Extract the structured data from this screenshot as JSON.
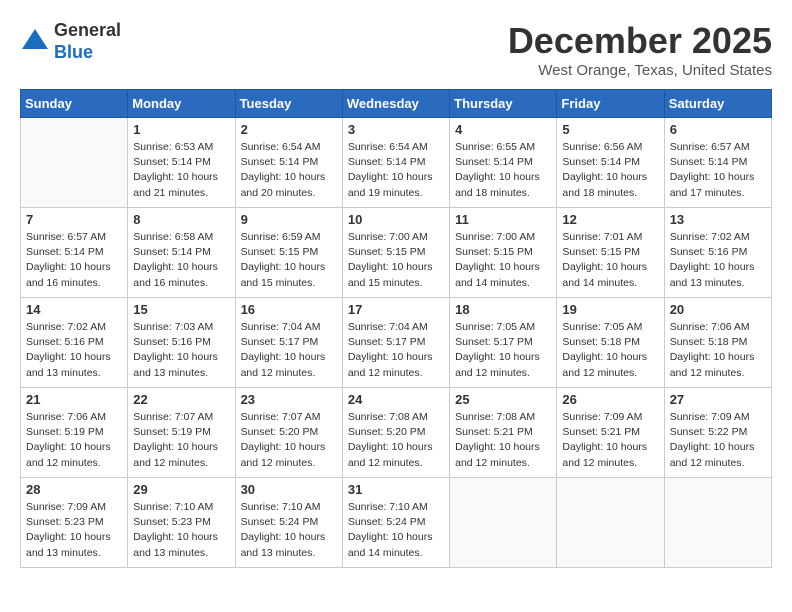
{
  "header": {
    "logo_line1": "General",
    "logo_line2": "Blue",
    "month": "December 2025",
    "location": "West Orange, Texas, United States"
  },
  "weekdays": [
    "Sunday",
    "Monday",
    "Tuesday",
    "Wednesday",
    "Thursday",
    "Friday",
    "Saturday"
  ],
  "weeks": [
    [
      {
        "day": "",
        "sunrise": "",
        "sunset": "",
        "daylight": ""
      },
      {
        "day": "1",
        "sunrise": "Sunrise: 6:53 AM",
        "sunset": "Sunset: 5:14 PM",
        "daylight": "Daylight: 10 hours and 21 minutes."
      },
      {
        "day": "2",
        "sunrise": "Sunrise: 6:54 AM",
        "sunset": "Sunset: 5:14 PM",
        "daylight": "Daylight: 10 hours and 20 minutes."
      },
      {
        "day": "3",
        "sunrise": "Sunrise: 6:54 AM",
        "sunset": "Sunset: 5:14 PM",
        "daylight": "Daylight: 10 hours and 19 minutes."
      },
      {
        "day": "4",
        "sunrise": "Sunrise: 6:55 AM",
        "sunset": "Sunset: 5:14 PM",
        "daylight": "Daylight: 10 hours and 18 minutes."
      },
      {
        "day": "5",
        "sunrise": "Sunrise: 6:56 AM",
        "sunset": "Sunset: 5:14 PM",
        "daylight": "Daylight: 10 hours and 18 minutes."
      },
      {
        "day": "6",
        "sunrise": "Sunrise: 6:57 AM",
        "sunset": "Sunset: 5:14 PM",
        "daylight": "Daylight: 10 hours and 17 minutes."
      }
    ],
    [
      {
        "day": "7",
        "sunrise": "Sunrise: 6:57 AM",
        "sunset": "Sunset: 5:14 PM",
        "daylight": "Daylight: 10 hours and 16 minutes."
      },
      {
        "day": "8",
        "sunrise": "Sunrise: 6:58 AM",
        "sunset": "Sunset: 5:14 PM",
        "daylight": "Daylight: 10 hours and 16 minutes."
      },
      {
        "day": "9",
        "sunrise": "Sunrise: 6:59 AM",
        "sunset": "Sunset: 5:15 PM",
        "daylight": "Daylight: 10 hours and 15 minutes."
      },
      {
        "day": "10",
        "sunrise": "Sunrise: 7:00 AM",
        "sunset": "Sunset: 5:15 PM",
        "daylight": "Daylight: 10 hours and 15 minutes."
      },
      {
        "day": "11",
        "sunrise": "Sunrise: 7:00 AM",
        "sunset": "Sunset: 5:15 PM",
        "daylight": "Daylight: 10 hours and 14 minutes."
      },
      {
        "day": "12",
        "sunrise": "Sunrise: 7:01 AM",
        "sunset": "Sunset: 5:15 PM",
        "daylight": "Daylight: 10 hours and 14 minutes."
      },
      {
        "day": "13",
        "sunrise": "Sunrise: 7:02 AM",
        "sunset": "Sunset: 5:16 PM",
        "daylight": "Daylight: 10 hours and 13 minutes."
      }
    ],
    [
      {
        "day": "14",
        "sunrise": "Sunrise: 7:02 AM",
        "sunset": "Sunset: 5:16 PM",
        "daylight": "Daylight: 10 hours and 13 minutes."
      },
      {
        "day": "15",
        "sunrise": "Sunrise: 7:03 AM",
        "sunset": "Sunset: 5:16 PM",
        "daylight": "Daylight: 10 hours and 13 minutes."
      },
      {
        "day": "16",
        "sunrise": "Sunrise: 7:04 AM",
        "sunset": "Sunset: 5:17 PM",
        "daylight": "Daylight: 10 hours and 12 minutes."
      },
      {
        "day": "17",
        "sunrise": "Sunrise: 7:04 AM",
        "sunset": "Sunset: 5:17 PM",
        "daylight": "Daylight: 10 hours and 12 minutes."
      },
      {
        "day": "18",
        "sunrise": "Sunrise: 7:05 AM",
        "sunset": "Sunset: 5:17 PM",
        "daylight": "Daylight: 10 hours and 12 minutes."
      },
      {
        "day": "19",
        "sunrise": "Sunrise: 7:05 AM",
        "sunset": "Sunset: 5:18 PM",
        "daylight": "Daylight: 10 hours and 12 minutes."
      },
      {
        "day": "20",
        "sunrise": "Sunrise: 7:06 AM",
        "sunset": "Sunset: 5:18 PM",
        "daylight": "Daylight: 10 hours and 12 minutes."
      }
    ],
    [
      {
        "day": "21",
        "sunrise": "Sunrise: 7:06 AM",
        "sunset": "Sunset: 5:19 PM",
        "daylight": "Daylight: 10 hours and 12 minutes."
      },
      {
        "day": "22",
        "sunrise": "Sunrise: 7:07 AM",
        "sunset": "Sunset: 5:19 PM",
        "daylight": "Daylight: 10 hours and 12 minutes."
      },
      {
        "day": "23",
        "sunrise": "Sunrise: 7:07 AM",
        "sunset": "Sunset: 5:20 PM",
        "daylight": "Daylight: 10 hours and 12 minutes."
      },
      {
        "day": "24",
        "sunrise": "Sunrise: 7:08 AM",
        "sunset": "Sunset: 5:20 PM",
        "daylight": "Daylight: 10 hours and 12 minutes."
      },
      {
        "day": "25",
        "sunrise": "Sunrise: 7:08 AM",
        "sunset": "Sunset: 5:21 PM",
        "daylight": "Daylight: 10 hours and 12 minutes."
      },
      {
        "day": "26",
        "sunrise": "Sunrise: 7:09 AM",
        "sunset": "Sunset: 5:21 PM",
        "daylight": "Daylight: 10 hours and 12 minutes."
      },
      {
        "day": "27",
        "sunrise": "Sunrise: 7:09 AM",
        "sunset": "Sunset: 5:22 PM",
        "daylight": "Daylight: 10 hours and 12 minutes."
      }
    ],
    [
      {
        "day": "28",
        "sunrise": "Sunrise: 7:09 AM",
        "sunset": "Sunset: 5:23 PM",
        "daylight": "Daylight: 10 hours and 13 minutes."
      },
      {
        "day": "29",
        "sunrise": "Sunrise: 7:10 AM",
        "sunset": "Sunset: 5:23 PM",
        "daylight": "Daylight: 10 hours and 13 minutes."
      },
      {
        "day": "30",
        "sunrise": "Sunrise: 7:10 AM",
        "sunset": "Sunset: 5:24 PM",
        "daylight": "Daylight: 10 hours and 13 minutes."
      },
      {
        "day": "31",
        "sunrise": "Sunrise: 7:10 AM",
        "sunset": "Sunset: 5:24 PM",
        "daylight": "Daylight: 10 hours and 14 minutes."
      },
      {
        "day": "",
        "sunrise": "",
        "sunset": "",
        "daylight": ""
      },
      {
        "day": "",
        "sunrise": "",
        "sunset": "",
        "daylight": ""
      },
      {
        "day": "",
        "sunrise": "",
        "sunset": "",
        "daylight": ""
      }
    ]
  ]
}
